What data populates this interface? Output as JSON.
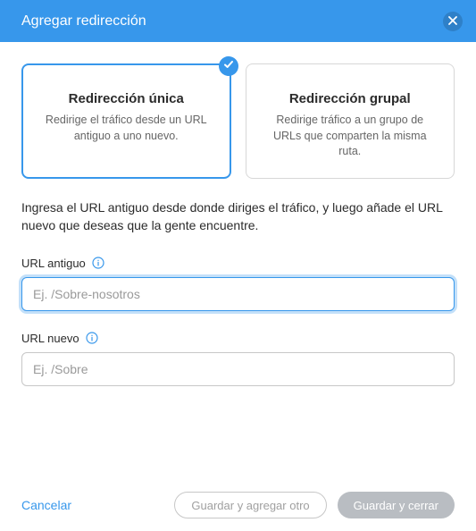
{
  "header": {
    "title": "Agregar redirección"
  },
  "cards": {
    "single": {
      "title": "Redirección única",
      "desc": "Redirige el tráfico desde un URL antiguo a uno nuevo."
    },
    "group": {
      "title": "Redirección grupal",
      "desc": "Redirige tráfico a un grupo de URLs que comparten la misma ruta."
    }
  },
  "intro": "Ingresa el URL antiguo desde donde diriges el tráfico, y luego añade el URL nuevo que deseas que la gente encuentre.",
  "fields": {
    "old": {
      "label": "URL antiguo",
      "placeholder": "Ej. /Sobre-nosotros",
      "value": ""
    },
    "new": {
      "label": "URL nuevo",
      "placeholder": "Ej. /Sobre",
      "value": ""
    }
  },
  "footer": {
    "cancel": "Cancelar",
    "save_another": "Guardar y agregar otro",
    "save_close": "Guardar y cerrar"
  },
  "colors": {
    "accent": "#3797eb"
  }
}
